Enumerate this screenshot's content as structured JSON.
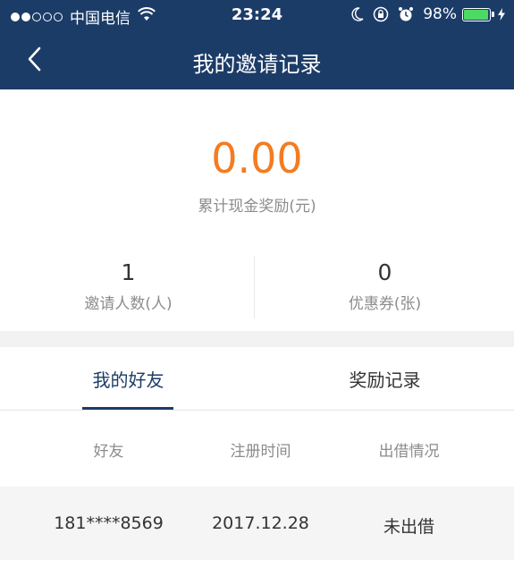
{
  "status_bar": {
    "signal_bars_filled": 2,
    "signal_bars_total": 5,
    "carrier": "中国电信",
    "time": "23:24",
    "battery_text": "98%",
    "battery_level": 0.98,
    "battery_color": "#4cd964"
  },
  "nav": {
    "title": "我的邀请记录",
    "back_icon": "chevron-left-icon",
    "background_color": "#1c3c68"
  },
  "summary": {
    "total_reward_value": "0.00",
    "total_reward_label": "累计现金奖励(元)",
    "value_color": "#f47c20",
    "invite_count_value": "1",
    "invite_count_label": "邀请人数(人)",
    "coupon_count_value": "0",
    "coupon_count_label": "优惠券(张)"
  },
  "tabs": [
    {
      "label": "我的好友",
      "active": true
    },
    {
      "label": "奖励记录",
      "active": false
    }
  ],
  "table": {
    "columns": [
      "好友",
      "注册时间",
      "出借情况"
    ],
    "rows": [
      [
        "181****8569",
        "2017.12.28",
        "未出借"
      ]
    ]
  }
}
